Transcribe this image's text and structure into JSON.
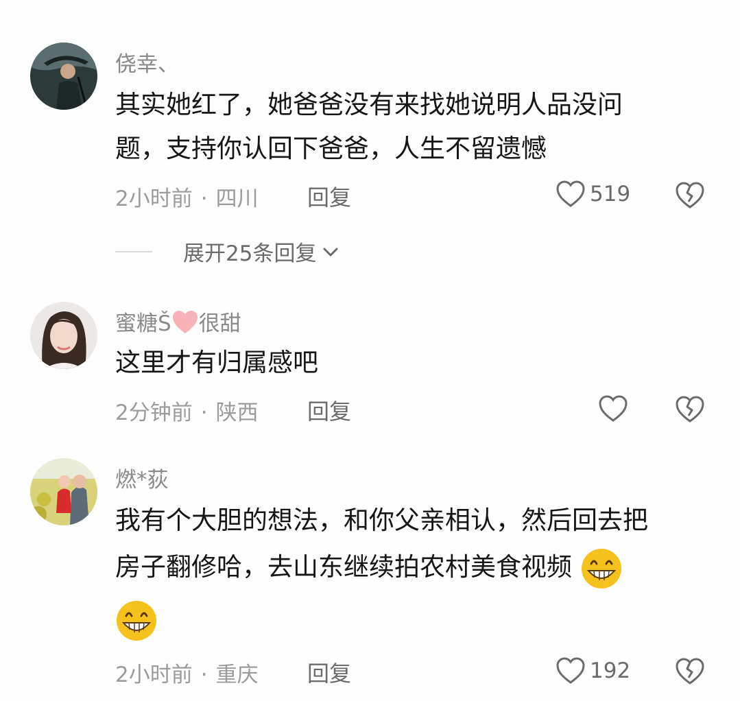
{
  "comments": [
    {
      "username": "侥幸、",
      "lines": [
        "其实她红了，她爸爸没有来找她说明人品没问",
        "题，支持你认回下爸爸，人生不留遗憾"
      ],
      "time": "2小时前",
      "location": "四川",
      "reply_label": "回复",
      "likes": "519",
      "avatar_icon": "man-with-umbrella-avatar"
    },
    {
      "username_prefix": "蜜糖Š",
      "username_suffix": "很甜",
      "lines": [
        "这里才有归属感吧"
      ],
      "time": "2分钟前",
      "location": "陕西",
      "reply_label": "回复",
      "likes": "",
      "avatar_icon": "woman-portrait-avatar"
    },
    {
      "username": "燃*荻",
      "lines": [
        "我有个大胆的想法，和你父亲相认，然后回去把",
        "房子翻修哈，去山东继续拍农村美食视频"
      ],
      "time": "2小时前",
      "location": "重庆",
      "reply_label": "回复",
      "likes": "192",
      "avatar_icon": "mother-and-child-avatar"
    }
  ],
  "expand": {
    "label": "展开25条回复"
  },
  "icons": {
    "like": "heart-outline-icon",
    "dislike": "broken-heart-icon",
    "expand_arrow": "chevron-down-icon",
    "emoji": "grinning-emoji-icon",
    "username_heart": "pink-heart-icon"
  },
  "colors": {
    "text": "#161616",
    "secondary": "#8a8a8a",
    "heart": "#f7b3b8",
    "emoji": "#f5c11c"
  }
}
